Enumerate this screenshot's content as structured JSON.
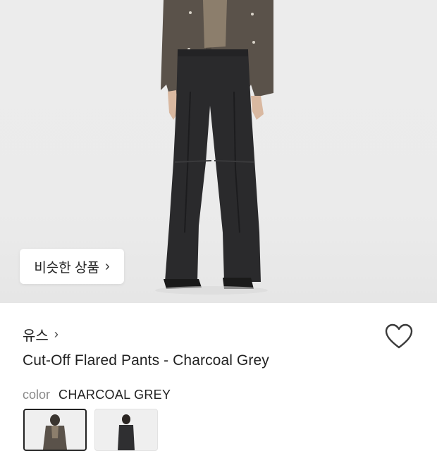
{
  "product": {
    "similar_button_label": "비슷한 상품",
    "brand_name": "유스",
    "name": "Cut-Off Flared Pants - Charcoal Grey",
    "color_label": "color",
    "color_value": "CHARCOAL GREY"
  },
  "icons": {
    "similar_chevron": "chevron-right-icon",
    "brand_chevron": "chevron-right-icon",
    "wishlist": "heart-outline-icon"
  },
  "colors": {
    "shirt": "#5a524a",
    "pants": "#2a2a2c",
    "background": "#ececec"
  }
}
